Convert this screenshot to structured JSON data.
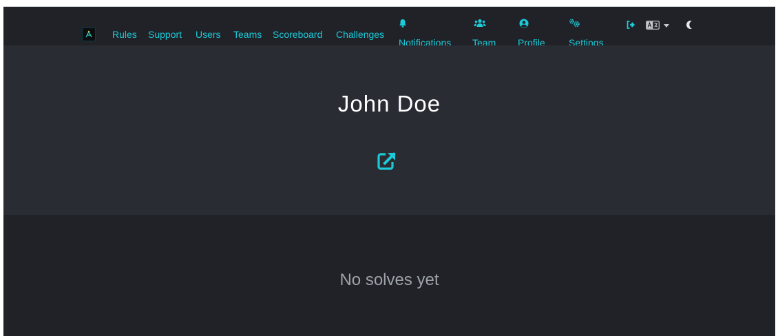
{
  "navbar": {
    "links": [
      "Rules",
      "Support",
      "Users",
      "Teams",
      "Scoreboard",
      "Challenges"
    ],
    "icon_items": [
      {
        "label": "Notifications",
        "icon": "bell-icon"
      },
      {
        "label": "Team",
        "icon": "users-icon"
      },
      {
        "label": "Profile",
        "icon": "user-circle-icon"
      },
      {
        "label": "Settings",
        "icon": "gears-icon"
      }
    ],
    "utilities": [
      "logout-icon",
      "language-icon",
      "caret-down-icon",
      "moon-icon"
    ]
  },
  "profile": {
    "name": "John Doe",
    "website_icon": "external-link-icon"
  },
  "solves": {
    "empty_text": "No solves yet"
  },
  "colors": {
    "accent": "#1ccad8",
    "nav_bg": "#202228",
    "hero_bg": "#2a2c33",
    "text_muted": "#9ea3aa"
  }
}
